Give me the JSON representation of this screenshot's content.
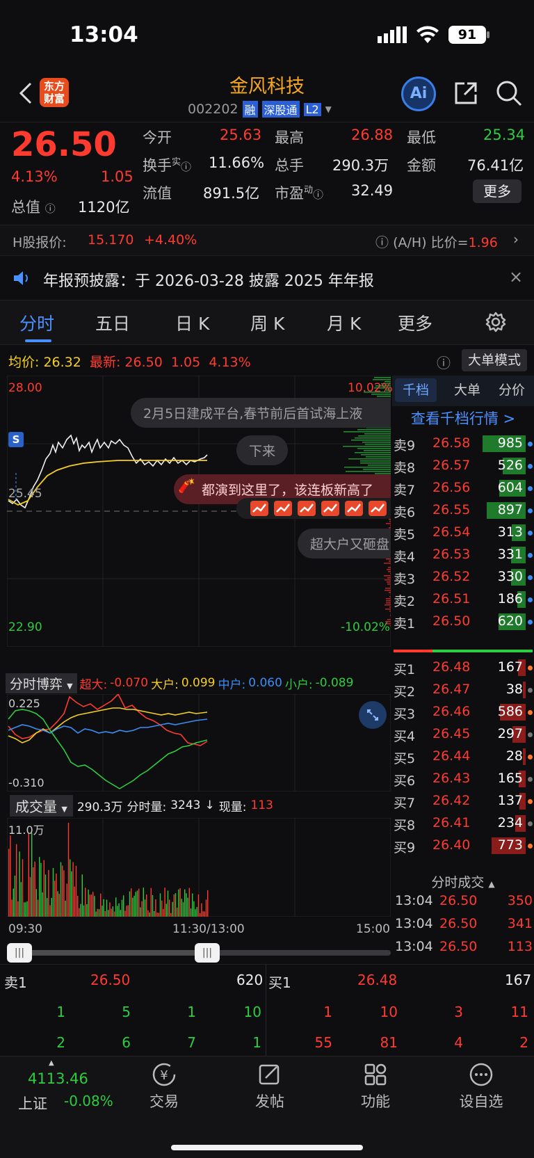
{
  "status": {
    "time": "13:04",
    "battery": "91"
  },
  "header": {
    "logo_line1": "东方",
    "logo_line2": "财富",
    "name": "金风科技",
    "code": "002202",
    "badges": [
      "融",
      "深股通",
      "L2"
    ],
    "ai_label": "Ai"
  },
  "quote": {
    "price": "26.50",
    "change_pct": "4.13%",
    "change": "1.05",
    "open_label": "今开",
    "open": "25.63",
    "high_label": "最高",
    "high": "26.88",
    "low_label": "最低",
    "low": "25.34",
    "turnover_label": "换手",
    "turnover_sup": "实",
    "turnover": "11.66%",
    "volume_label": "总手",
    "volume": "290.3万",
    "amount_label": "金额",
    "amount": "76.41亿",
    "mktcap_label": "总值",
    "mktcap": "1120亿",
    "float_label": "流值",
    "float": "891.5亿",
    "pe_label": "市盈",
    "pe_sup": "动",
    "pe": "32.49",
    "more_button": "更多"
  },
  "hshare": {
    "label": "H股报价:",
    "price": "15.170",
    "change": "+4.40%",
    "ah_label": "(A/H) 比价=",
    "ah_value": "1.96"
  },
  "notice": {
    "text": "年报预披露：于 2026-03-28 披露 2025 年年报"
  },
  "tabs": [
    "分时",
    "五日",
    "日 K",
    "周 K",
    "月 K",
    "更多"
  ],
  "chart": {
    "avg_label": "均价:",
    "avg": "26.32",
    "latest_label": "最新:",
    "latest": "26.50",
    "latest_chg": "1.05",
    "latest_pct": "4.13%",
    "big_order_button": "大单模式",
    "y_top": "28.00",
    "y_mid": "25.45",
    "y_bot": "22.90",
    "pct_top": "10.02%",
    "pct_bot": "-10.02%",
    "s_marker": "S",
    "comments": [
      "2月5日建成平台,春节前后首试海上液",
      "下来",
      "都演到这里了，该连板新高了",
      "超大户又砸盘"
    ],
    "game_label": "分时博弈",
    "super_label": "超大:",
    "super": "-0.070",
    "big_label": "大户:",
    "big": "0.099",
    "mid_label": "中户:",
    "mid": "0.060",
    "small_label": "小户:",
    "small": "-0.089",
    "game_top": "0.225",
    "game_bot": "-0.310",
    "vol_label": "成交量",
    "vol_total": "290.3万",
    "vol_min_label": "分时量:",
    "vol_min": "3243",
    "vol_now_label": "现量:",
    "vol_now": "113",
    "vol_top": "11.0万",
    "time_start": "09:30",
    "time_mid": "11:30/13:00",
    "time_end": "15:00"
  },
  "book": {
    "tabs": [
      "千档",
      "大单",
      "分价"
    ],
    "link": "查看千档行情 >",
    "asks": [
      {
        "label": "卖9",
        "price": "26.58",
        "vol": "985"
      },
      {
        "label": "卖8",
        "price": "26.57",
        "vol": "526"
      },
      {
        "label": "卖7",
        "price": "26.56",
        "vol": "604"
      },
      {
        "label": "卖6",
        "price": "26.55",
        "vol": "897"
      },
      {
        "label": "卖5",
        "price": "26.54",
        "vol": "313"
      },
      {
        "label": "卖4",
        "price": "26.53",
        "vol": "331"
      },
      {
        "label": "卖3",
        "price": "26.52",
        "vol": "330"
      },
      {
        "label": "卖2",
        "price": "26.51",
        "vol": "186"
      },
      {
        "label": "卖1",
        "price": "26.50",
        "vol": "620"
      }
    ],
    "bids": [
      {
        "label": "买1",
        "price": "26.48",
        "vol": "167"
      },
      {
        "label": "买2",
        "price": "26.47",
        "vol": "38"
      },
      {
        "label": "买3",
        "price": "26.46",
        "vol": "586"
      },
      {
        "label": "买4",
        "price": "26.45",
        "vol": "297"
      },
      {
        "label": "买5",
        "price": "26.44",
        "vol": "28"
      },
      {
        "label": "买6",
        "price": "26.43",
        "vol": "165"
      },
      {
        "label": "买7",
        "price": "26.42",
        "vol": "137"
      },
      {
        "label": "买8",
        "price": "26.41",
        "vol": "234"
      },
      {
        "label": "买9",
        "price": "26.40",
        "vol": "773"
      }
    ],
    "trades_title": "分时成交",
    "trades": [
      {
        "time": "13:04",
        "price": "26.50",
        "vol": "350"
      },
      {
        "time": "13:04",
        "price": "26.50",
        "vol": "341"
      },
      {
        "time": "13:04",
        "price": "26.50",
        "vol": "113"
      }
    ]
  },
  "queue": {
    "sell_label": "卖1",
    "sell_price": "26.50",
    "sell_vol": "620",
    "buy_label": "买1",
    "buy_price": "26.48",
    "buy_vol": "167",
    "sell_row1": [
      "1",
      "5",
      "1",
      "10"
    ],
    "sell_row2": [
      "2",
      "6",
      "7",
      "1"
    ],
    "buy_row1": [
      "1",
      "10",
      "3",
      "11"
    ],
    "buy_row2": [
      "55",
      "81",
      "4",
      "2"
    ]
  },
  "nav": {
    "index_value": "4113.46",
    "index_name": "上证",
    "index_change": "-0.08%",
    "items": [
      "交易",
      "发帖",
      "功能",
      "设自选"
    ]
  }
}
